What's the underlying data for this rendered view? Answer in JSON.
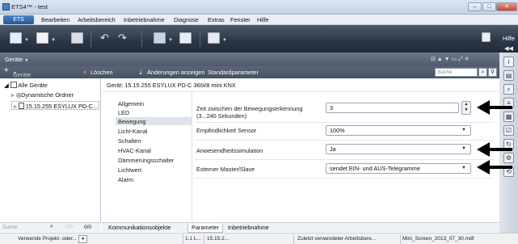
{
  "window": {
    "title": "ETS4™ - test",
    "buttons": {
      "minimize": "–",
      "maximize": "□",
      "close": "✕"
    }
  },
  "menubar": {
    "ets_label": "ETS",
    "items": [
      "Bearbeiten",
      "Arbeitsbereich",
      "Inbetriebnahme",
      "Diagnose",
      "Extras",
      "Fenster",
      "Hilfe"
    ]
  },
  "toolbar": {
    "help_label": "Hilfe"
  },
  "panel": {
    "title": "Geräte",
    "title_caret": "▼",
    "controls": "⊟ ▲ ▼   ▭ ⤢ ✕"
  },
  "subtoolbar": {
    "add_devices": "Geräte hinzufügen",
    "add_caret": "▼",
    "delete": "Löschen",
    "download_changes": "Änderungen anzeigen",
    "default_params": "Standardparameter",
    "search_placeholder": "Suche"
  },
  "tree": {
    "root": "Alle Geräte",
    "items": [
      "Dynamische Ordner",
      "15.15.255   ESYLUX PD-C..."
    ],
    "search_placeholder": "Suche",
    "pager": "0/0"
  },
  "device_header": "Gerät: 15.15.255  ESYLUX PD-C 360i/8 mini KNX",
  "param_groups": {
    "items": [
      "Allgemein",
      "LED",
      "Bewegung",
      "Licht-Kanal",
      "Schalten",
      "HVAC-Kanal",
      "Dämmerungsschalter",
      "Lichtwert",
      "Alarm"
    ],
    "selected": "Bewegung"
  },
  "params": [
    {
      "label": "Zeit zwischen der Bewegungserkennung\n(3...240 Sekunden)",
      "value": "3",
      "type": "spin"
    },
    {
      "label": "Empfindlichkeit Sensor",
      "value": "100%",
      "type": "select"
    },
    {
      "label": "Anwesendheitssimulation",
      "value": "Ja",
      "type": "select"
    },
    {
      "label": "Externer Master/Slave",
      "value": "sendet EIN- und AUS-Telegramme",
      "type": "select"
    }
  ],
  "tabs": [
    "Kommunikationsobjekte",
    "Parameter",
    "Inbetriebnahme"
  ],
  "active_tab": "Parameter",
  "status": {
    "project_mode": "Verwende Projekt- oder...",
    "line": "1.1 L...",
    "address": "15.15.2...",
    "workspace": "Zuletzt verwendeter Arbeitsbere...",
    "screen_file": "Mini_Screen_2013_07_30.mdf"
  },
  "colors": {
    "toolbar_dark": "#2b3644",
    "panel_header": "#5a6676",
    "selection": "#dde3eb",
    "annotation_arrow": "#000000"
  }
}
